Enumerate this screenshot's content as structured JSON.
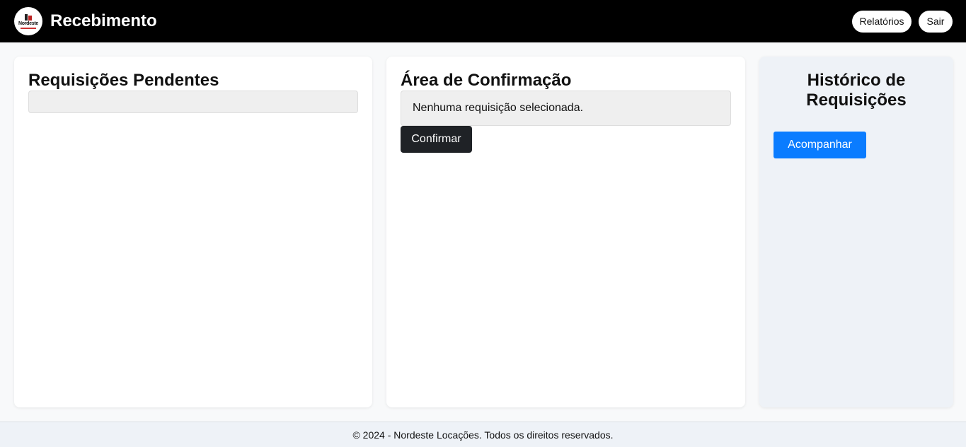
{
  "header": {
    "logo_text": "Nordeste",
    "title": "Recebimento",
    "reports_label": "Relatórios",
    "logout_label": "Sair"
  },
  "pending": {
    "title": "Requisições Pendentes"
  },
  "confirmation": {
    "title": "Área de Confirmação",
    "empty_message": "Nenhuma requisição selecionada.",
    "confirm_label": "Confirmar"
  },
  "history": {
    "title": "Histórico de Requisições",
    "track_label": "Acompanhar"
  },
  "footer": {
    "text": "© 2024 - Nordeste Locações. Todos os direitos reservados."
  },
  "colors": {
    "header_bg": "#000000",
    "confirm_button": "#1f2226",
    "track_button": "#0a7cff",
    "history_bg": "#eef2f7"
  }
}
